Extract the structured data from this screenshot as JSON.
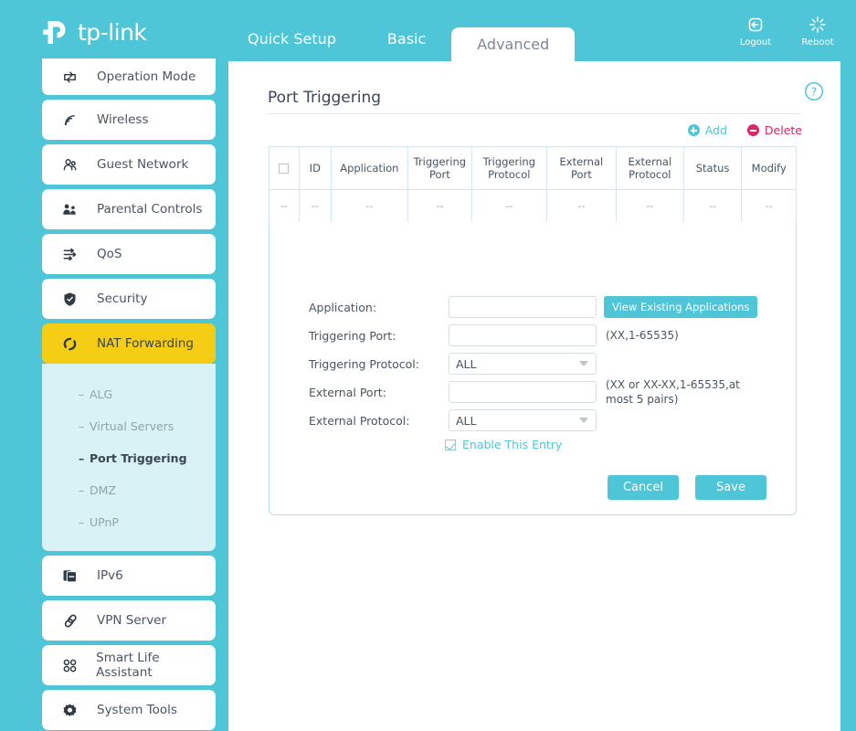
{
  "brand": {
    "name": "tp-link",
    "logo_icon": "tplink-logo"
  },
  "colors": {
    "teal": "#4ec6d8",
    "yellow": "#f5cd14",
    "crimson": "#d6286b",
    "submenu_bg": "#d9f2f6"
  },
  "header": {
    "tabs": [
      {
        "label": "Quick Setup",
        "active": false
      },
      {
        "label": "Basic",
        "active": false
      },
      {
        "label": "Advanced",
        "active": true
      }
    ],
    "actions": [
      {
        "label": "Logout",
        "icon": "logout-icon"
      },
      {
        "label": "Reboot",
        "icon": "reboot-icon"
      }
    ]
  },
  "sidebar": {
    "items": [
      {
        "label": "Operation Mode",
        "icon": "operation-mode-icon",
        "active": false
      },
      {
        "label": "Wireless",
        "icon": "wireless-icon",
        "active": false
      },
      {
        "label": "Guest Network",
        "icon": "guest-network-icon",
        "active": false
      },
      {
        "label": "Parental Controls",
        "icon": "parental-controls-icon",
        "active": false
      },
      {
        "label": "QoS",
        "icon": "qos-icon",
        "active": false
      },
      {
        "label": "Security",
        "icon": "security-icon",
        "active": false
      },
      {
        "label": "NAT Forwarding",
        "icon": "nat-forwarding-icon",
        "active": true
      },
      {
        "label": "IPv6",
        "icon": "ipv6-icon",
        "active": false
      },
      {
        "label": "VPN Server",
        "icon": "vpn-server-icon",
        "active": false
      },
      {
        "label": "Smart Life Assistant",
        "icon": "smart-life-assistant-icon",
        "active": false
      },
      {
        "label": "System Tools",
        "icon": "system-tools-icon",
        "active": false
      }
    ],
    "submenu": [
      {
        "label": "ALG",
        "active": false
      },
      {
        "label": "Virtual Servers",
        "active": false
      },
      {
        "label": "Port Triggering",
        "active": true
      },
      {
        "label": "DMZ",
        "active": false
      },
      {
        "label": "UPnP",
        "active": false
      }
    ],
    "submenu_dash": "–"
  },
  "main": {
    "page_title": "Port Triggering",
    "help_icon": "help-icon",
    "table_actions": {
      "add_label": "Add",
      "delete_label": "Delete",
      "add_icon": "plus-circle-icon",
      "delete_icon": "minus-circle-icon"
    },
    "table": {
      "headers": [
        "",
        "ID",
        "Application",
        "Triggering Port",
        "Triggering Protocol",
        "External Port",
        "External Protocol",
        "Status",
        "Modify"
      ],
      "rows": [
        [
          "--",
          "--",
          "--",
          "--",
          "--",
          "--",
          "--",
          "--",
          "--"
        ]
      ],
      "select_all_icon": "checkbox-unchecked-icon"
    },
    "form": {
      "fields": [
        {
          "label": "Application:",
          "type": "text",
          "value": "",
          "placeholder": "",
          "button": "View Existing Applications",
          "hint": ""
        },
        {
          "label": "Triggering Port:",
          "type": "text",
          "value": "",
          "placeholder": "",
          "hint": "(XX,1-65535)"
        },
        {
          "label": "Triggering Protocol:",
          "type": "select",
          "value": "ALL",
          "hint": ""
        },
        {
          "label": "External Port:",
          "type": "text",
          "value": "",
          "placeholder": "",
          "hint": "(XX or XX-XX,1-65535,at most 5 pairs)"
        },
        {
          "label": "External Protocol:",
          "type": "select",
          "value": "ALL",
          "hint": ""
        }
      ],
      "enable_label": "Enable This Entry",
      "enable_checked": true,
      "cancel_label": "Cancel",
      "save_label": "Save"
    }
  }
}
